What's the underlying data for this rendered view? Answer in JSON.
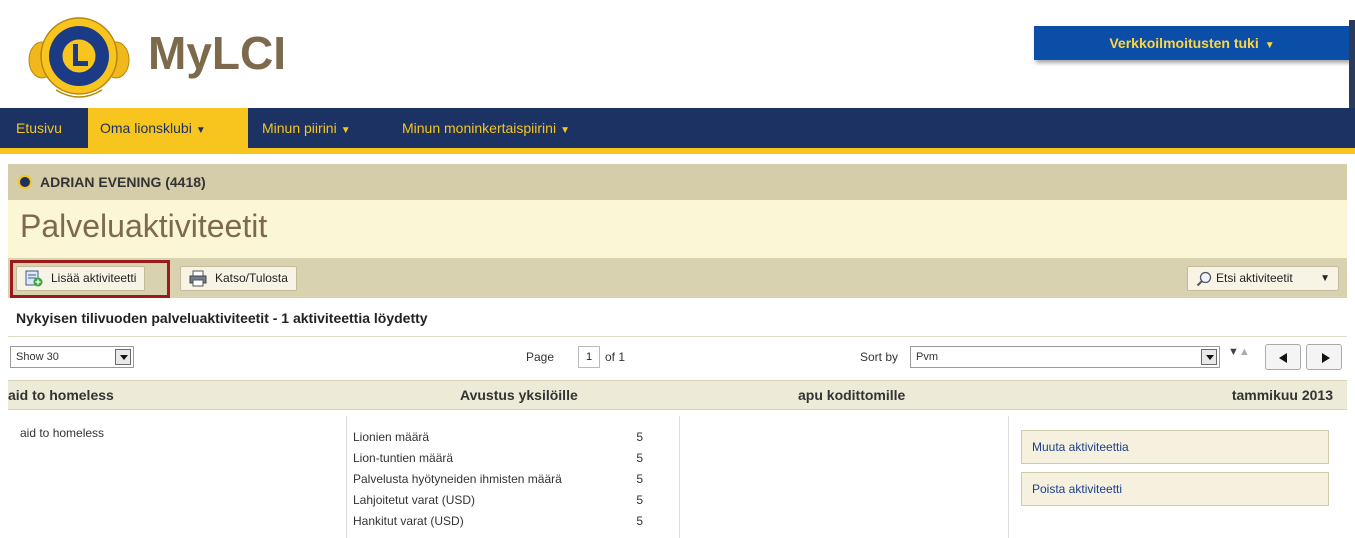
{
  "header": {
    "brand": "MyLCI",
    "logo_name": "lions-international-logo",
    "support_label": "Verkkoilmoitusten tuki",
    "colors": {
      "brand_text": "#7d6a4c",
      "support_bg": "#0a4ea8",
      "support_text": "#ffd640"
    }
  },
  "nav": {
    "items": [
      {
        "label": "Etusivu",
        "has_caret": false,
        "active": false
      },
      {
        "label": "Oma lionsklubi",
        "has_caret": true,
        "active": true
      },
      {
        "label": "Minun piirini",
        "has_caret": true,
        "active": false
      },
      {
        "label": "Minun moninkertaispiirini",
        "has_caret": true,
        "active": false
      }
    ],
    "colors": {
      "bg": "#1b3262",
      "accent": "#f7c51e"
    }
  },
  "club": {
    "name": "ADRIAN EVENING (4418)"
  },
  "page": {
    "title": "Palveluaktiviteetit"
  },
  "toolbar": {
    "add_label": "Lisää aktiviteetti",
    "print_label": "Katso/Tulosta",
    "search_label": "Etsi aktiviteetit"
  },
  "list": {
    "subtitle": "Nykyisen tilivuoden palveluaktiviteetit - 1 aktiviteettia löydetty",
    "show_select": "Show 30",
    "page_label": "Page",
    "page_value": "1",
    "page_of": "of 1",
    "sort_label": "Sort by",
    "sort_select": "Pvm"
  },
  "activity": {
    "title": "aid to homeless",
    "category": "Avustus yksilöille",
    "type": "apu kodittomille",
    "date": "tammikuu 2013",
    "description": "aid to homeless",
    "stats": [
      {
        "label": "Lionien määrä",
        "value": "5"
      },
      {
        "label": "Lion-tuntien määrä",
        "value": "5"
      },
      {
        "label": "Palvelusta hyötyneiden ihmisten määrä",
        "value": "5"
      },
      {
        "label": "Lahjoitetut varat (USD)",
        "value": "5"
      },
      {
        "label": "Hankitut varat (USD)",
        "value": "5"
      }
    ],
    "actions": {
      "edit_label": "Muuta aktiviteettia",
      "delete_label": "Poista aktiviteetti"
    }
  }
}
